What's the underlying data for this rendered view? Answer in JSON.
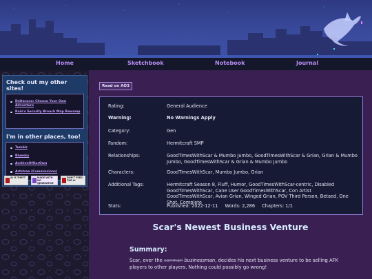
{
  "nav": {
    "items": [
      "Home",
      "Sketchbook",
      "Notebook",
      "Journal"
    ]
  },
  "sidebar": {
    "sites_title": "Check out my other sites!",
    "sites": [
      "Deltarune: Choose Your Own Adventure",
      "Rain's Security Breach Map Rewamp"
    ],
    "places_title": "I'm in other places, too!",
    "places": [
      "Tumblr",
      "Bluesky",
      "ArchiveOfOurOwn",
      "Artstraa (Commissions)"
    ],
    "badges": [
      "AI IS THEFT",
      "MADE WITH NO GENERATIVE AI",
      "DON'T FEED THE AI"
    ]
  },
  "work": {
    "ao3_button": "Read on AO3",
    "meta": [
      {
        "key": "Rating:",
        "value": "General Audience"
      },
      {
        "key": "Warning:",
        "value": "No Warnings Apply",
        "bold": true
      },
      {
        "key": "Category:",
        "value": "Gen"
      },
      {
        "key": "Fandom:",
        "value": "Hermitcraft SMP"
      },
      {
        "key": "Relationships:",
        "value": "GoodTimesWithScar & Mumbo Jumbo, GoodTimesWithScar & Grian, Grian & Mumbo Jumbo, GoodTimesWithScar & Grian & Mumbo Jumbo"
      },
      {
        "key": "Characters:",
        "value": "GoodTimesWithScar, Mumbo Jumbo, Grian"
      },
      {
        "key": "Additional Tags:",
        "value": "Hermitcraft Season 8, Fluff, Humor, GoodTimesWithScar-centric, Disabled GoodTimesWithScar, Cane User GoodTimesWithScar, Con Artist GoodTimesWithScar, Avian Grian, Winged Grian, POV Third Person, Betaed, One Shot, Complete"
      }
    ],
    "stats_label": "Stats:",
    "stats": {
      "published": "Published: 2022-12-11",
      "words": "Words: 2,286",
      "chapters": "Chapters: 1/1"
    },
    "title": "Scar's Newest Business Venture",
    "summary_heading": "Summary:",
    "summary_pre": "Scar, ever the ",
    "summary_strike": "conman",
    "summary_em": "businessman",
    "summary_post": ", decides his next business venture to be selling AFK players to other players. Nothing could possibly go wrong!"
  },
  "colors": {
    "banner": "#3a4a9c",
    "nav_bg": "#141629",
    "nav_link": "#b98ef5",
    "sidebar_box": "#1e3a66",
    "main_bg": "#3a1f52",
    "meta_bg": "#171a34",
    "title": "#d7ecff"
  }
}
